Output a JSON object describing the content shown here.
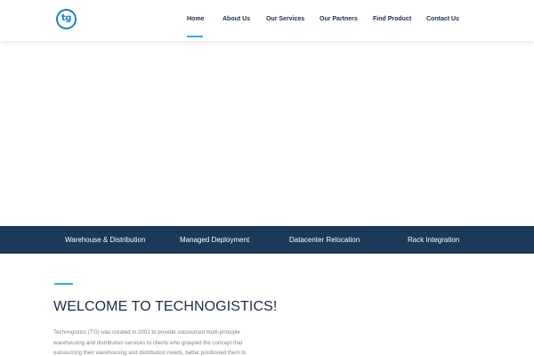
{
  "header": {
    "logo_text": "tg",
    "nav": [
      {
        "label": "Home",
        "active": true
      },
      {
        "label": "About Us"
      },
      {
        "label": "Our Services"
      },
      {
        "label": "Our Partners"
      },
      {
        "label": "Find Product"
      },
      {
        "label": "Contact Us"
      }
    ]
  },
  "services": [
    {
      "label": "Warehouse & Distribution"
    },
    {
      "label": "Managed Deployment"
    },
    {
      "label": "Datacenter Relocation"
    },
    {
      "label": "Rack Integration"
    }
  ],
  "welcome": {
    "title": "WELCOME TO TECHNOGISTICS!",
    "body": "Technogistics (TG) was created in 2001 to provide outsourced multi-principle warehousing and distribution services to clients who grasped the concept that outsourcing their warehousing and distribution needs, better positioned them to"
  },
  "colors": {
    "brand_blue": "#1a7fc4",
    "accent": "#2fb0e6",
    "navy_bar": "#1b3959",
    "heading": "#1c2d44"
  }
}
